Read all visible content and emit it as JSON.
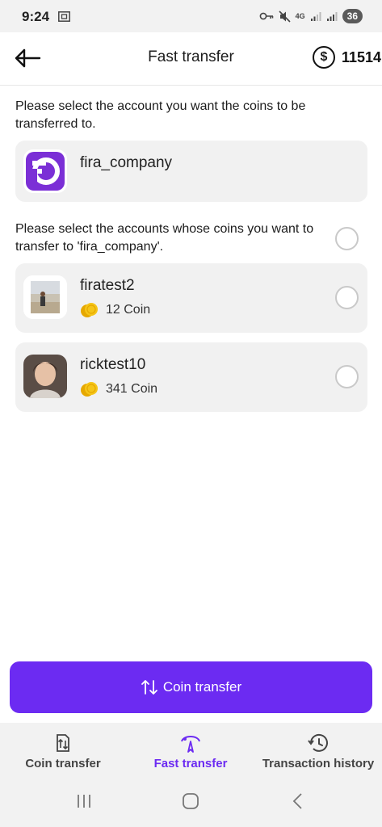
{
  "status_bar": {
    "time": "9:24",
    "battery": "36",
    "network": "4G"
  },
  "header": {
    "title": "Fast transfer",
    "balance_symbol": "$",
    "balance": "11514"
  },
  "target_section": {
    "instruction": "Please select the account you want the coins to be transferred to.",
    "account": {
      "name": "fira_company",
      "logo_color": "#7b2fd6"
    }
  },
  "source_section": {
    "instruction": "Please select the accounts whose coins you want to transfer to 'fira_company'.",
    "accounts": [
      {
        "name": "firatest2",
        "coins": "12 Coin"
      },
      {
        "name": "ricktest10",
        "coins": "341 Coin"
      }
    ]
  },
  "transfer_button": {
    "label": "Coin transfer"
  },
  "tabs": [
    {
      "label": "Coin transfer",
      "icon": "coin-transfer-icon"
    },
    {
      "label": "Fast transfer",
      "icon": "fast-transfer-icon"
    },
    {
      "label": "Transaction history",
      "icon": "history-icon"
    }
  ],
  "colors": {
    "accent": "#6c2bf2",
    "card_bg": "#f1f1f1",
    "coin": "#f5b900"
  }
}
